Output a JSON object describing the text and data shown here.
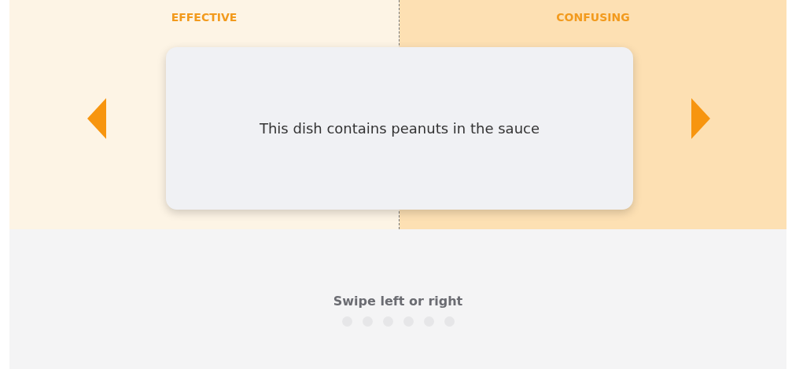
{
  "zones": [
    {
      "label": "EFFECTIVE",
      "kind": "left"
    },
    {
      "label": "CONFUSING",
      "kind": "right"
    }
  ],
  "card": {
    "text": "This dish contains peanuts in the sauce"
  },
  "hint": "Swipe left or right",
  "dots": [
    {
      "selected": false
    },
    {
      "selected": false
    },
    {
      "selected": false
    },
    {
      "selected": false
    },
    {
      "selected": false
    },
    {
      "selected": false
    }
  ]
}
